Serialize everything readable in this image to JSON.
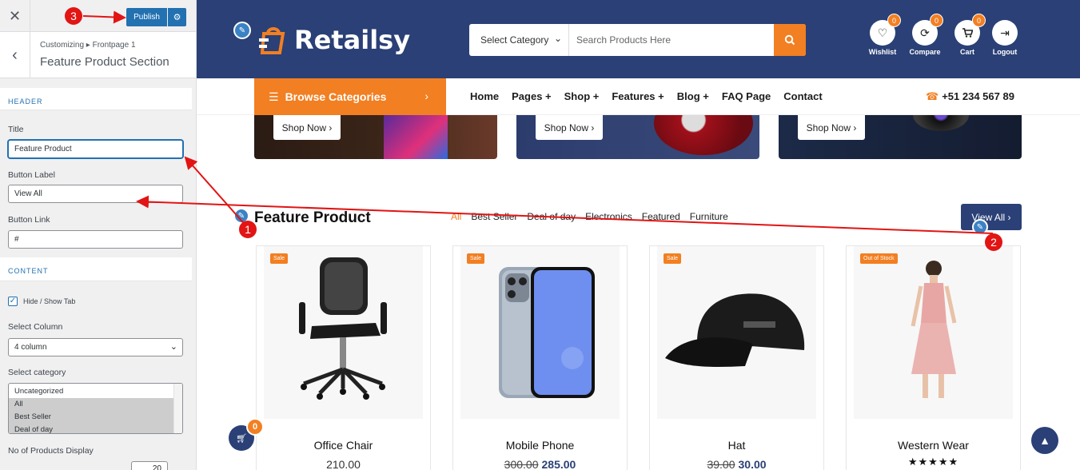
{
  "customizer": {
    "publish": "Publish",
    "breadcrumb": "Customizing ▸ Frontpage 1",
    "section_title": "Feature Product Section",
    "header_band": "HEADER",
    "title_label": "Title",
    "title_value": "Feature Product",
    "button_label_label": "Button Label",
    "button_label_value": "View All",
    "button_link_label": "Button Link",
    "button_link_value": "#",
    "content_band": "CONTENT",
    "hide_show_tab": "Hide / Show Tab",
    "select_column_label": "Select Column",
    "select_column_value": "4 column",
    "select_category_label": "Select category",
    "categories": [
      "Uncategorized",
      "All",
      "Best Seller",
      "Deal of day"
    ],
    "products_display_label": "No of Products Display",
    "products_display_value": "20"
  },
  "site": {
    "logo": "Retailsy",
    "search": {
      "category": "Select Category",
      "placeholder": "Search Products Here"
    },
    "header_icons": [
      {
        "label": "Wishlist",
        "count": "0",
        "icon": "heart-icon"
      },
      {
        "label": "Compare",
        "count": "0",
        "icon": "refresh-icon"
      },
      {
        "label": "Cart",
        "count": "0",
        "icon": "cart-icon"
      },
      {
        "label": "Logout",
        "icon": "logout-icon"
      }
    ],
    "browse_categories": "Browse Categories",
    "nav": [
      "Home",
      "Pages +",
      "Shop +",
      "Features +",
      "Blog +",
      "FAQ Page",
      "Contact"
    ],
    "phone": "+51 234 567 89",
    "shop_now": "Shop Now ›",
    "section_title": "Feature Product",
    "tabs": [
      "All",
      "Best Seller",
      "Deal of day",
      "Electronics",
      "Featured",
      "Furniture"
    ],
    "view_all": "View All ›",
    "products": [
      {
        "tag": "Sale",
        "name": "Office Chair",
        "price": "210.00"
      },
      {
        "tag": "Sale",
        "name": "Mobile Phone",
        "old_price": "300.00",
        "price": "285.00"
      },
      {
        "tag": "Sale",
        "name": "Hat",
        "old_price": "39.00",
        "price": "30.00"
      },
      {
        "tag": "Out of Stock",
        "name": "Western Wear",
        "rating": "★★★★★"
      }
    ],
    "cart_count": "0"
  },
  "annotations": [
    "1",
    "2",
    "3"
  ],
  "colors": {
    "accent": "#f27f22",
    "brand": "#2a4076",
    "wp_blue": "#2271b1",
    "annotation": "#e21414"
  }
}
